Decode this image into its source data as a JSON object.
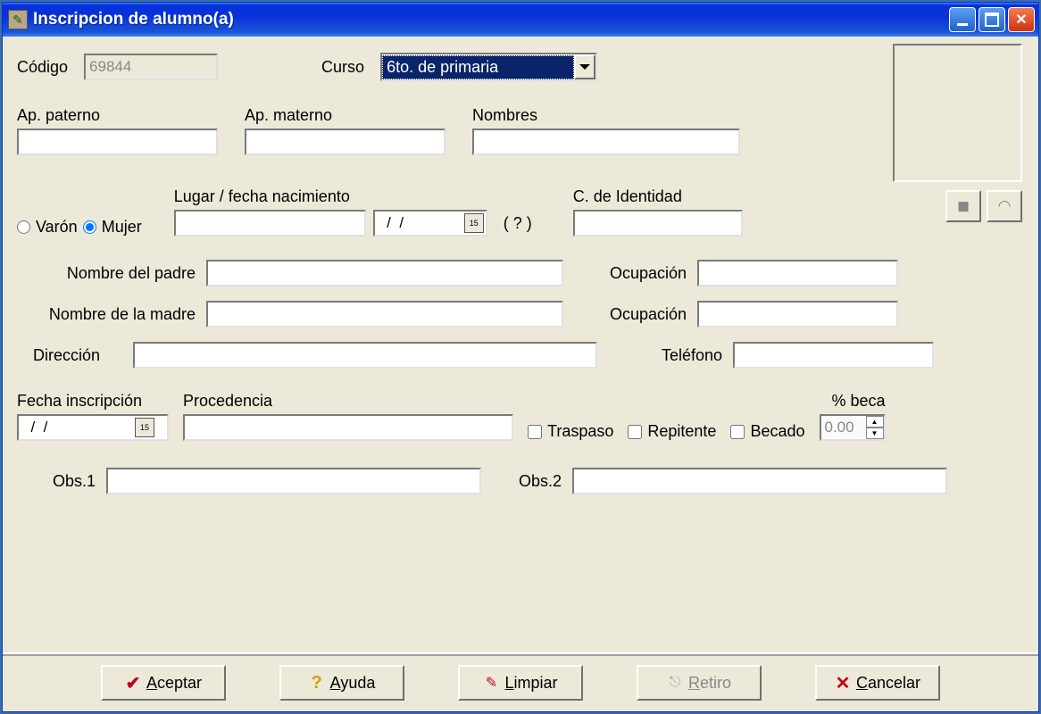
{
  "window": {
    "title": "Inscripcion de alumno(a)"
  },
  "labels": {
    "codigo": "Código",
    "curso": "Curso",
    "ap_paterno": "Ap. paterno",
    "ap_materno": "Ap. materno",
    "nombres": "Nombres",
    "varon": "Varón",
    "mujer": "Mujer",
    "lugar_fecha_nac": "Lugar / fecha nacimiento",
    "c_identidad": "C. de Identidad",
    "question": "( ? )",
    "nombre_padre": "Nombre del padre",
    "ocupacion": "Ocupación",
    "nombre_madre": "Nombre de la madre",
    "direccion": "Dirección",
    "telefono": "Teléfono",
    "fecha_inscripcion": "Fecha inscripción",
    "procedencia": "Procedencia",
    "traspaso": "Traspaso",
    "repitente": "Repitente",
    "becado": "Becado",
    "pct_beca": "% beca",
    "obs1": "Obs.1",
    "obs2": "Obs.2"
  },
  "values": {
    "codigo": "69844",
    "curso": "6to. de primaria",
    "ap_paterno": "",
    "ap_materno": "",
    "nombres": "",
    "sexo": "mujer",
    "lugar_nac": "",
    "fecha_nac": "  /  /",
    "c_identidad": "",
    "nombre_padre": "",
    "ocupacion_padre": "",
    "nombre_madre": "",
    "ocupacion_madre": "",
    "direccion": "",
    "telefono": "",
    "fecha_inscripcion": "  /  /",
    "procedencia": "",
    "traspaso": false,
    "repitente": false,
    "becado": false,
    "pct_beca": "0.00",
    "obs1": "",
    "obs2": ""
  },
  "buttons": {
    "aceptar": "Aceptar",
    "ayuda": "Ayuda",
    "limpiar": "Limpiar",
    "retiro": "Retiro",
    "cancelar": "Cancelar"
  }
}
